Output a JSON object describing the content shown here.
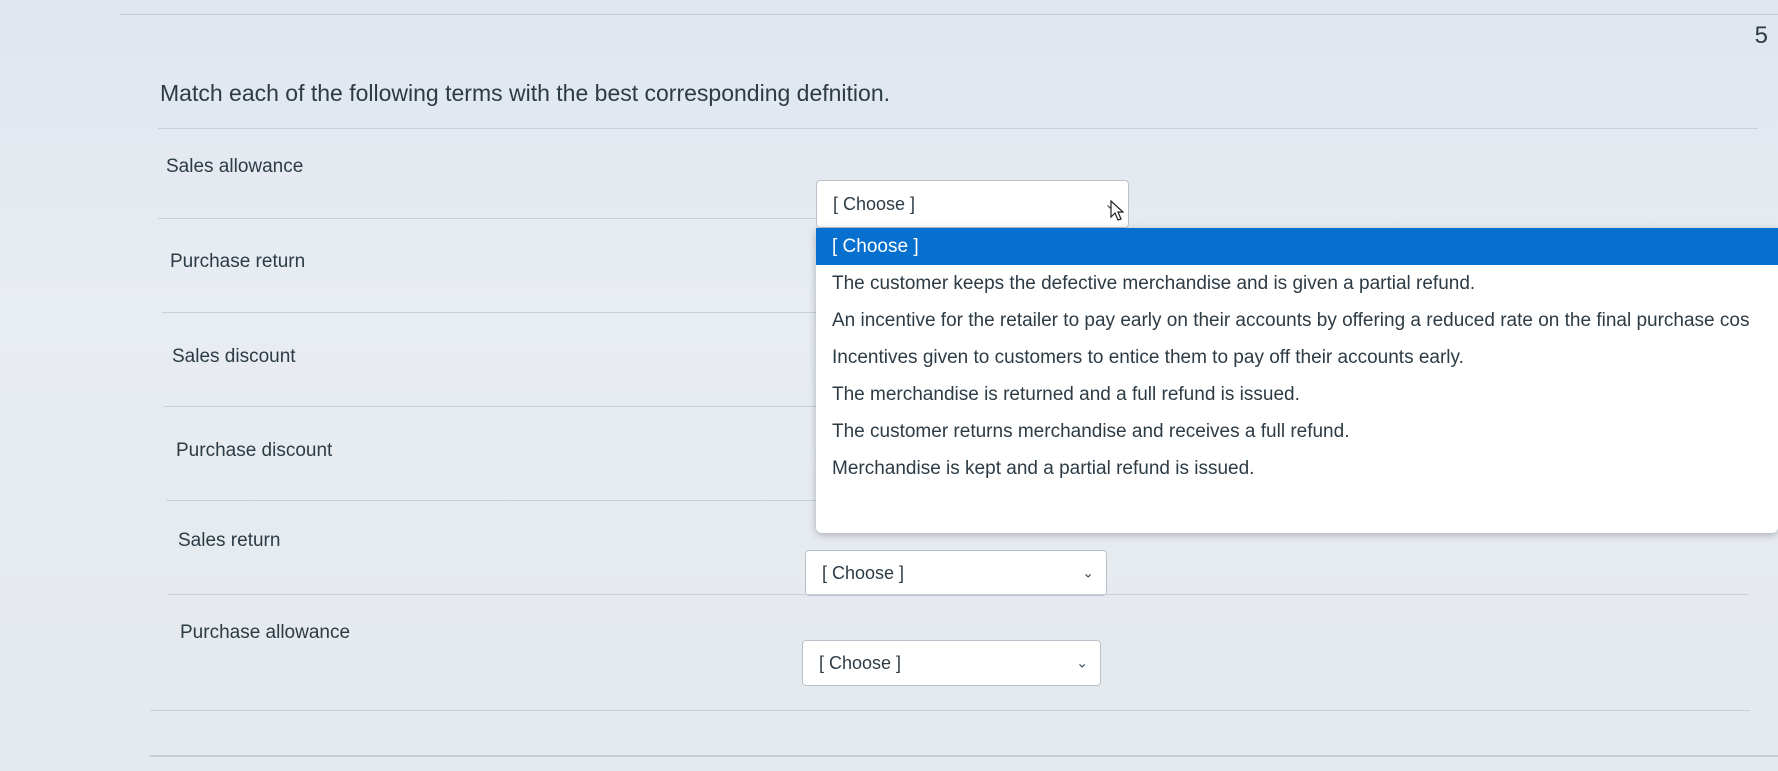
{
  "question": {
    "number": "5",
    "text": "Match each of the following terms with the best corresponding defnition."
  },
  "terms": [
    {
      "label": "Sales allowance",
      "selected": "[ Choose ]"
    },
    {
      "label": "Purchase return",
      "selected": "[ Choose ]"
    },
    {
      "label": "Sales discount",
      "selected": "[ Choose ]"
    },
    {
      "label": "Purchase discount",
      "selected": "[ Choose ]"
    },
    {
      "label": "Sales return",
      "selected": "[ Choose ]"
    },
    {
      "label": "Purchase allowance",
      "selected": "[ Choose ]"
    }
  ],
  "dropdown": {
    "options": [
      "[ Choose ]",
      "The customer keeps the defective merchandise and is given a partial refund.",
      "An incentive for the retailer to pay early on their accounts by offering a reduced rate on the final purchase cos",
      "Incentives given to customers to entice them to pay off their accounts early.",
      "The merchandise is returned and a full refund is issued.",
      "The customer returns merchandise and receives a full refund.",
      "Merchandise is kept and a partial refund is issued."
    ],
    "highlight_color": "#0770cf"
  }
}
